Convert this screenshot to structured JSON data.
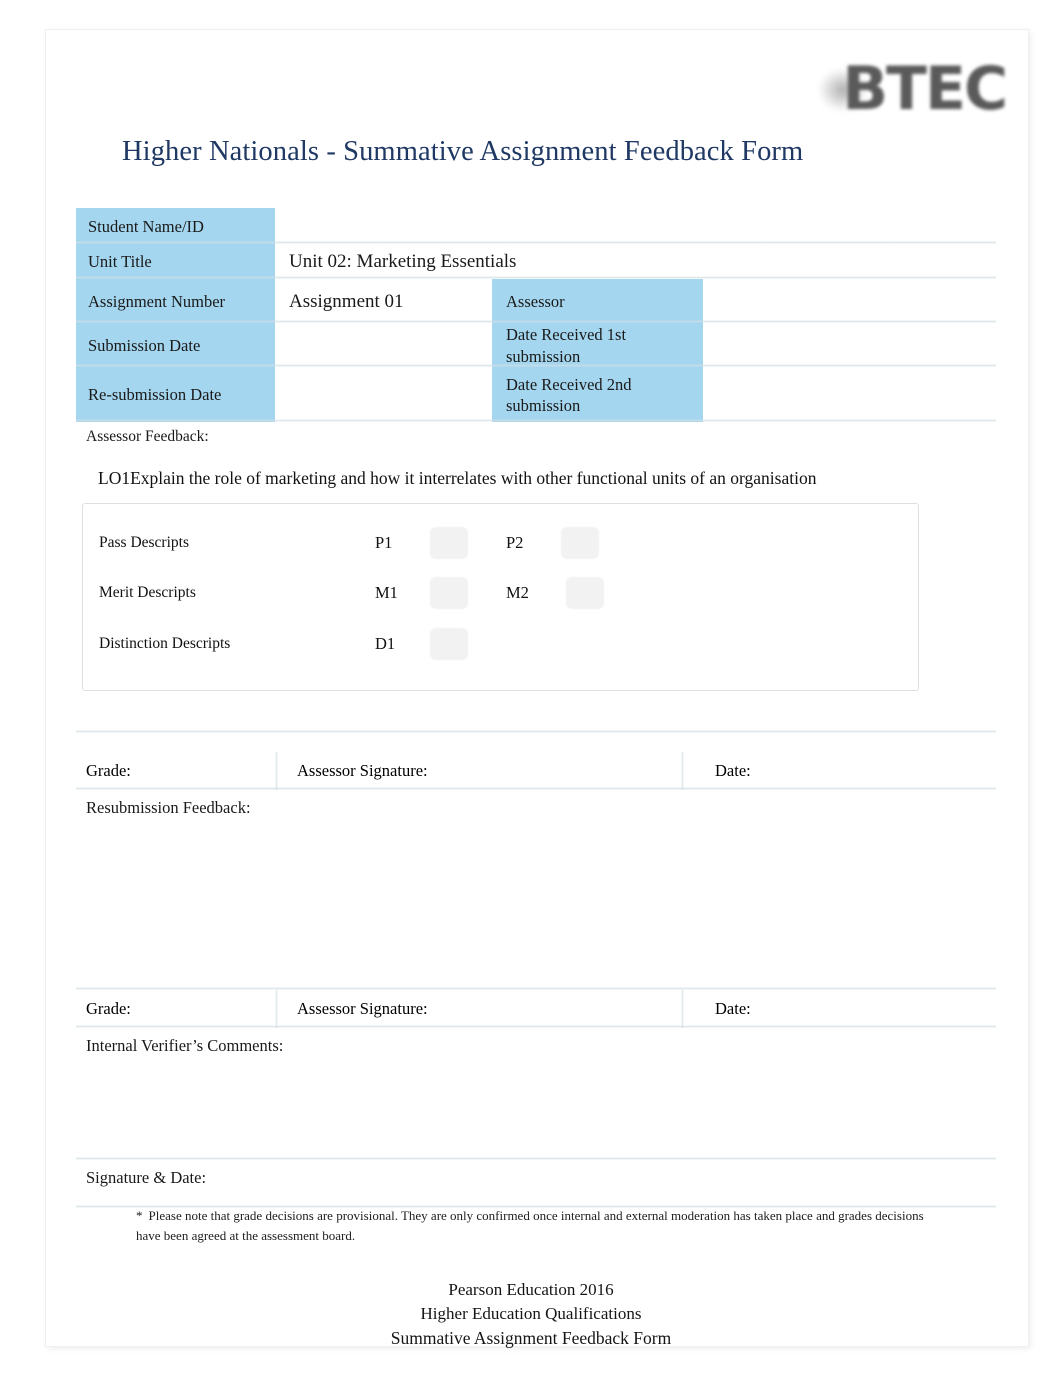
{
  "logo": {
    "text": "BTEC",
    "icon": "btec-logo"
  },
  "title": "Higher Nationals - Summative Assignment Feedback Form",
  "info_table": {
    "rows": [
      {
        "label": "Student Name/ID",
        "value": ""
      },
      {
        "label": "Unit Title",
        "value": "Unit 02: Marketing Essentials"
      },
      {
        "label": "Assignment  Number",
        "value": "Assignment 01",
        "label2": "Assessor",
        "value2": ""
      },
      {
        "label": "Submission Date",
        "value": "",
        "label2": "Date  Received  1st submission",
        "value2": ""
      },
      {
        "label": "Re-submission  Date",
        "value": "",
        "label2": "Date  Received  2nd submission",
        "value2": ""
      }
    ]
  },
  "feedback": {
    "label": "Assessor  Feedback:",
    "learning_outcome": "LO1Explain the role of marketing and how it interrelates with other functional units of an organisation",
    "descriptors": [
      {
        "name": "Pass Descripts",
        "code1": "P1",
        "code2": "P2"
      },
      {
        "name": "Merit Descripts",
        "code1": "M1",
        "code2": "M2"
      },
      {
        "name": "Distinction Descripts",
        "code1": "D1",
        "code2": ""
      }
    ]
  },
  "grade_row_1": {
    "grade": "Grade:",
    "signature": "Assessor Signature:",
    "date": "Date:"
  },
  "resubmission": {
    "label": "Resubmission Feedback:"
  },
  "grade_row_2": {
    "grade": "Grade:",
    "signature": "Assessor Signature:",
    "date": "Date:"
  },
  "internal_verifier": {
    "label": "Internal Verifier’s Comments:"
  },
  "signature_date": {
    "label": "Signature & Date:"
  },
  "footnote": {
    "star": "*",
    "text": "Please note that grade decisions are provisional. They are only confirmed once internal and external moderation has taken place and grades decisions have been agreed at the assessment board."
  },
  "footer": {
    "line1": "Pearson Education 2016",
    "line2": "Higher Education Qualifications",
    "line3": "Summative Assignment Feedback Form"
  },
  "colors": {
    "title_blue": "#1f3864",
    "header_cell_blue": "#a4d6ef",
    "seam_gray": "#d4e0e6"
  }
}
